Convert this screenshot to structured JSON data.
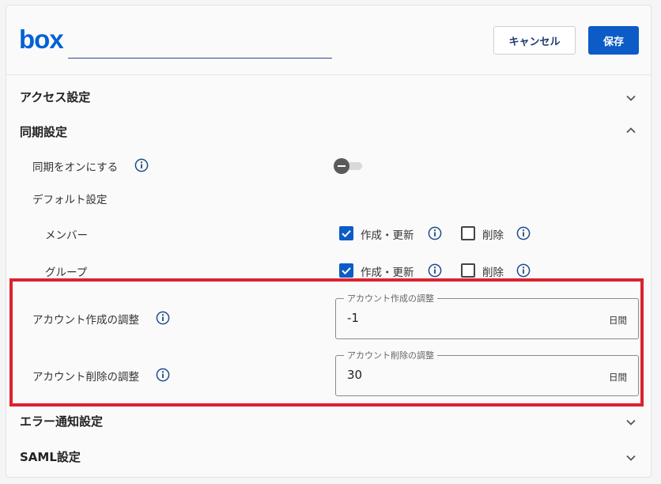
{
  "brand": {
    "logo_text": "box",
    "color": "#0061d5"
  },
  "header": {
    "name_input_value": "",
    "cancel_label": "キャンセル",
    "save_label": "保存"
  },
  "sections": {
    "access": "アクセス設定",
    "sync": "同期設定",
    "error": "エラー通知設定",
    "saml": "SAML設定"
  },
  "sync": {
    "enable_label": "同期をオンにする",
    "enable_state": "off",
    "default_label": "デフォルト設定",
    "member_label": "メンバー",
    "group_label": "グループ",
    "create_update_label": "作成・更新",
    "delete_label": "削除",
    "member_create_update_checked": true,
    "member_delete_checked": false,
    "group_create_update_checked": true,
    "group_delete_checked": false
  },
  "adjustments": {
    "create_label": "アカウント作成の調整",
    "create_field_legend": "アカウント作成の調整",
    "create_value": "-1",
    "delete_label": "アカウント削除の調整",
    "delete_field_legend": "アカウント削除の調整",
    "delete_value": "30",
    "unit": "日間"
  },
  "colors": {
    "primary": "#0d5bc6",
    "highlight_border": "#d9232f",
    "info_icon": "#1e4a8c"
  }
}
